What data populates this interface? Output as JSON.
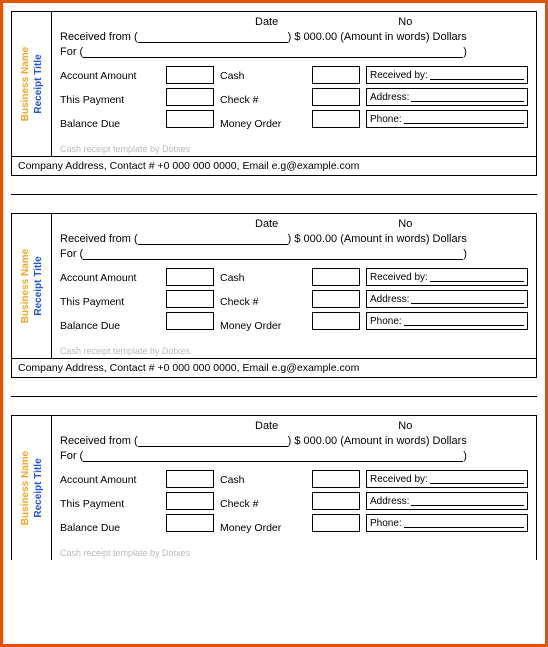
{
  "sidebar": {
    "business": "Business Name",
    "title": "Receipt Title"
  },
  "labels": {
    "date": "Date",
    "no": "No",
    "received_from": "Received from (",
    "amount_suffix": ") $ 000.00 (Amount in words) Dollars",
    "for": "For (",
    "account_amount": "Account Amount",
    "this_payment": "This Payment",
    "balance_due": "Balance Due",
    "cash": "Cash",
    "check": "Check #",
    "money_order": "Money Order",
    "received_by": "Received by:",
    "address": "Address:",
    "phone": "Phone:"
  },
  "credit": "Cash receipt template by Dotxes",
  "footer": "Company Address, Contact # +0 000 000 0000, Email e.g@example.com"
}
